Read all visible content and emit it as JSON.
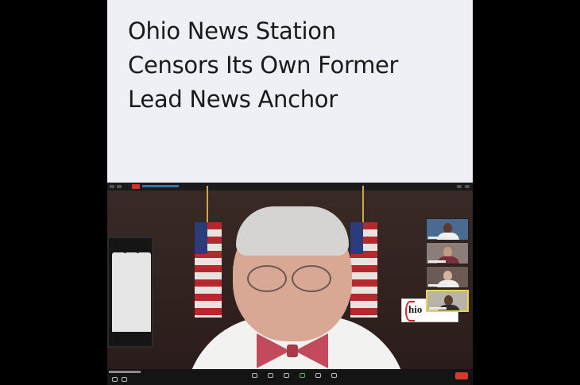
{
  "headline": {
    "line1": "Ohio News Station",
    "line2": "Censors Its Own Former",
    "line3": "Lead News Anchor"
  },
  "sign": {
    "text": "hio"
  },
  "colors": {
    "headline_bg": "#eef0f5",
    "headline_text": "#1a1a1a",
    "end_button": "#d33a2c",
    "active_speaker_border": "#e6d84a"
  },
  "icons": [
    "record-icon",
    "mute-icon",
    "video-icon",
    "security-icon",
    "participants-icon",
    "chat-icon",
    "share-icon",
    "reactions-icon",
    "end-call-icon"
  ]
}
